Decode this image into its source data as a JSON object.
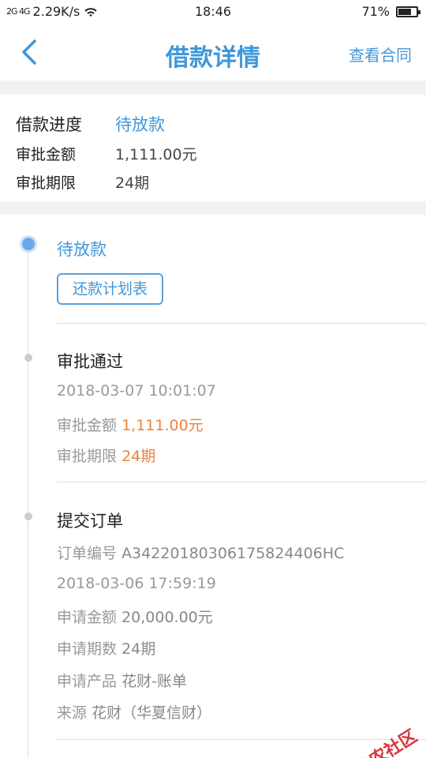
{
  "status_bar": {
    "signal": "2G 4G",
    "speed": "2.29K/s",
    "time": "18:46",
    "battery_text": "71%",
    "battery_level": 0.71
  },
  "navbar": {
    "title": "借款详情",
    "action": "查看合同",
    "back_icon": "chevron-left-icon"
  },
  "summary": {
    "progress_label": "借款进度",
    "progress_value": "待放款",
    "amount_label": "审批金额",
    "amount_value": "1,111.00元",
    "term_label": "审批期限",
    "term_value": "24期"
  },
  "timeline": {
    "current": {
      "title": "待放款",
      "button": "还款计划表"
    },
    "approved": {
      "title": "审批通过",
      "time": "2018-03-07 10:01:07",
      "amount_label": "审批金额",
      "amount_value": "1,111.00元",
      "term_label": "审批期限",
      "term_value": "24期"
    },
    "submitted": {
      "title": "提交订单",
      "order_label": "订单编号",
      "order_value": "A3422018030617582440 6HC",
      "time": "2018-03-06 17:59:19",
      "apply_amount_label": "申请金额",
      "apply_amount_value": "20,000.00元",
      "apply_term_label": "申请期数",
      "apply_term_value": "24期",
      "product_label": "申请产品",
      "product_value": "花财-账单",
      "source_label": "来源",
      "source_value": "花财（华夏信财）"
    }
  },
  "watermark": {
    "text": "卡农社区"
  },
  "colors": {
    "accent": "#3f97d9",
    "highlight": "#e8833a",
    "muted": "#999999"
  }
}
